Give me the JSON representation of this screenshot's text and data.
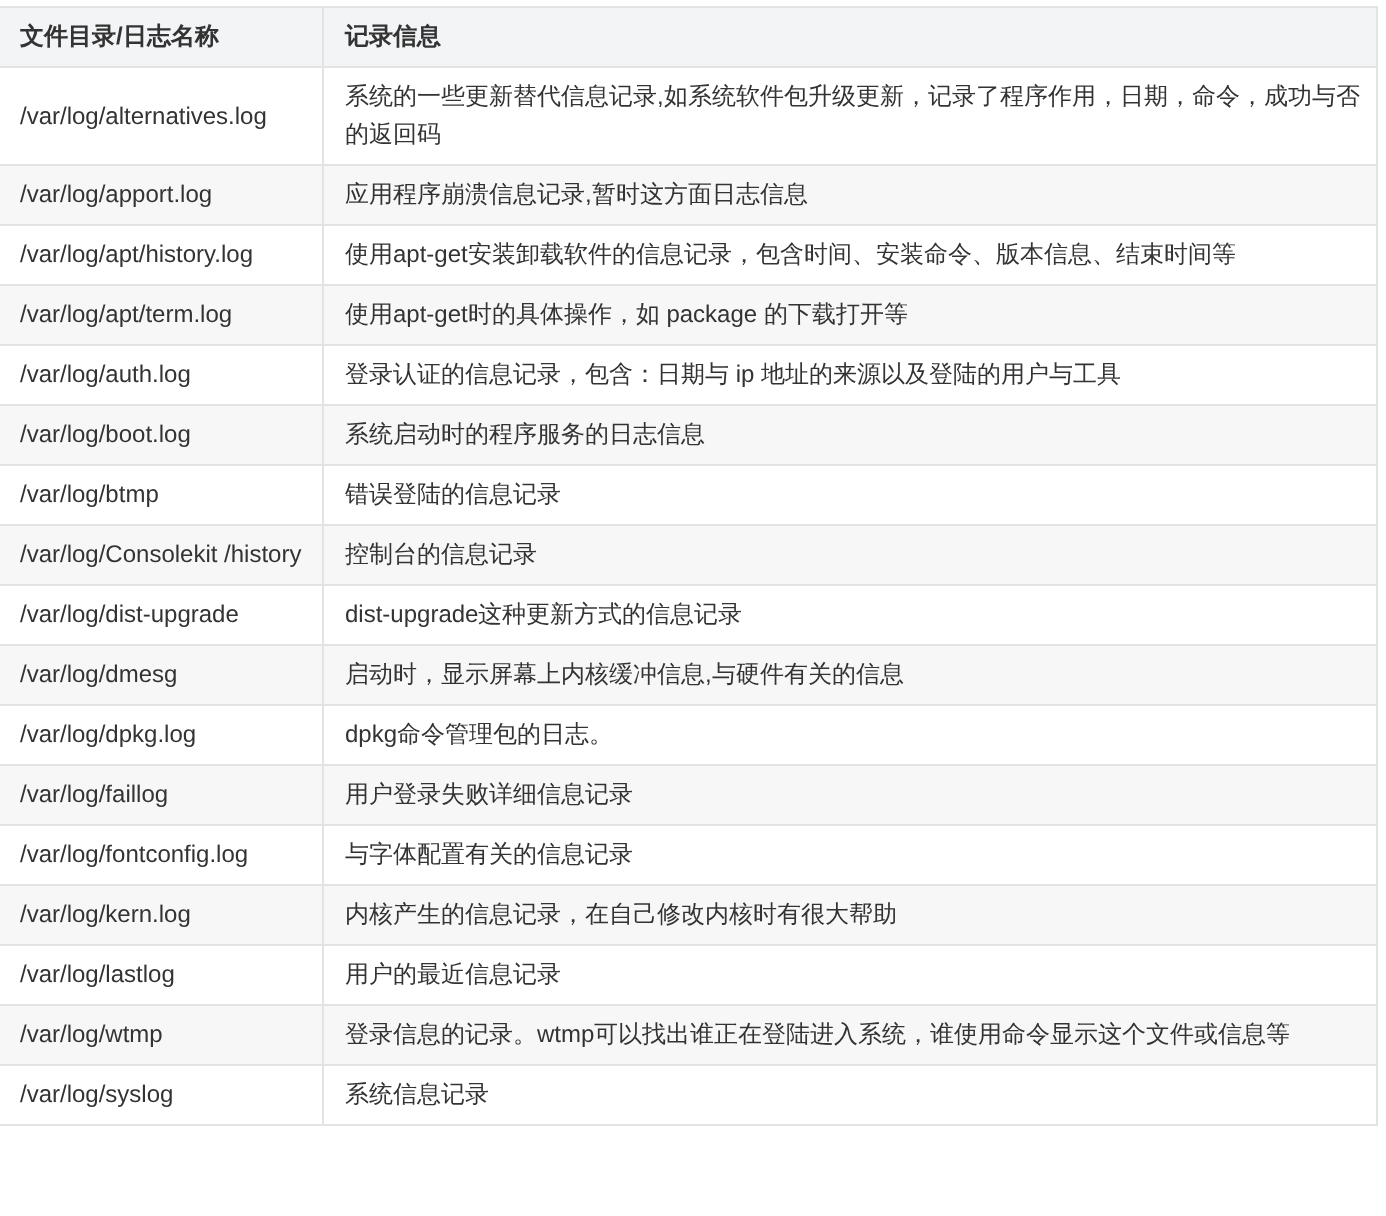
{
  "table": {
    "columns": [
      "文件目录/日志名称",
      "记录信息"
    ],
    "rows": [
      {
        "path": "/var/log/alternatives.log",
        "info": "系统的一些更新替代信息记录,如系统软件包升级更新，记录了程序作用，日期，命令，成功与否的返回码"
      },
      {
        "path": "/var/log/apport.log",
        "info": "应用程序崩溃信息记录,暂时这方面日志信息"
      },
      {
        "path": "/var/log/apt/history.log",
        "info": "使用apt-get安装卸载软件的信息记录，包含时间、安装命令、版本信息、结束时间等"
      },
      {
        "path": "/var/log/apt/term.log",
        "info": "使用apt-get时的具体操作，如 package 的下载打开等"
      },
      {
        "path": "/var/log/auth.log",
        "info": "登录认证的信息记录，包含：日期与 ip 地址的来源以及登陆的用户与工具"
      },
      {
        "path": "/var/log/boot.log",
        "info": "系统启动时的程序服务的日志信息"
      },
      {
        "path": "/var/log/btmp",
        "info": "错误登陆的信息记录"
      },
      {
        "path": "/var/log/Consolekit /history",
        "info": "控制台的信息记录"
      },
      {
        "path": "/var/log/dist-upgrade",
        "info": "dist-upgrade这种更新方式的信息记录"
      },
      {
        "path": "/var/log/dmesg",
        "info": "启动时，显示屏幕上内核缓冲信息,与硬件有关的信息"
      },
      {
        "path": "/var/log/dpkg.log",
        "info": "dpkg命令管理包的日志。"
      },
      {
        "path": "/var/log/faillog",
        "info": "用户登录失败详细信息记录"
      },
      {
        "path": "/var/log/fontconfig.log",
        "info": "与字体配置有关的信息记录"
      },
      {
        "path": "/var/log/kern.log",
        "info": "内核产生的信息记录，在自己修改内核时有很大帮助"
      },
      {
        "path": "/var/log/lastlog",
        "info": "用户的最近信息记录"
      },
      {
        "path": "/var/log/wtmp",
        "info": "登录信息的记录。wtmp可以找出谁正在登陆进入系统，谁使用命令显示这个文件或信息等"
      },
      {
        "path": "/var/log/syslog",
        "info": "系统信息记录"
      }
    ]
  }
}
